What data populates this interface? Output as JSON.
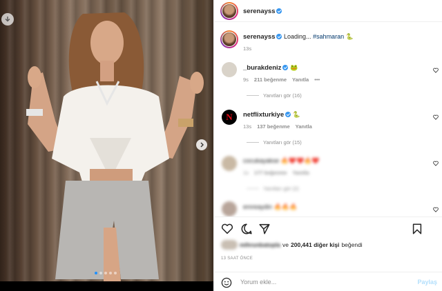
{
  "header": {
    "username": "serenayss",
    "more_label": "•••"
  },
  "caption": {
    "username": "serenayss",
    "text": "Loading... ",
    "hashtag": "#sahmaran",
    "emoji": "🐍",
    "time": "13s"
  },
  "comments": [
    {
      "username": "_burakdeniz",
      "emoji": "🐸",
      "time": "9s",
      "likes": "211 beğenme",
      "reply": "Yanıtla",
      "more": "•••",
      "view_replies": "Yanıtları gör (16)"
    },
    {
      "username": "netflixturkiye",
      "emoji": "🐍",
      "time": "13s",
      "likes": "137 beğenme",
      "reply": "Yanıtla",
      "view_replies": "Yanıtları gör (15)"
    },
    {
      "username": "cocukayakse",
      "emoji": "🔥❤️❤️🔥❤️",
      "time": "1s",
      "likes": "177 beğenme",
      "reply": "Yanıtla",
      "view_replies": "Yanıtları gör (2)"
    },
    {
      "username": "emreaydin",
      "emoji": "🔥🔥🔥"
    }
  ],
  "likes": {
    "liker": "mihrunbatopla",
    "joiner": "ve",
    "count_text": "200,441 diğer kişi",
    "suffix": "beğendi"
  },
  "timestamp": "13 SAAT ÖNCE",
  "comment_input": {
    "placeholder": "Yorum ekle...",
    "post_label": "Paylaş"
  },
  "colors": {
    "link": "#00376b",
    "muted": "#8e8e8e",
    "verified": "#3897f0",
    "post_disabled": "#b2dffc"
  }
}
